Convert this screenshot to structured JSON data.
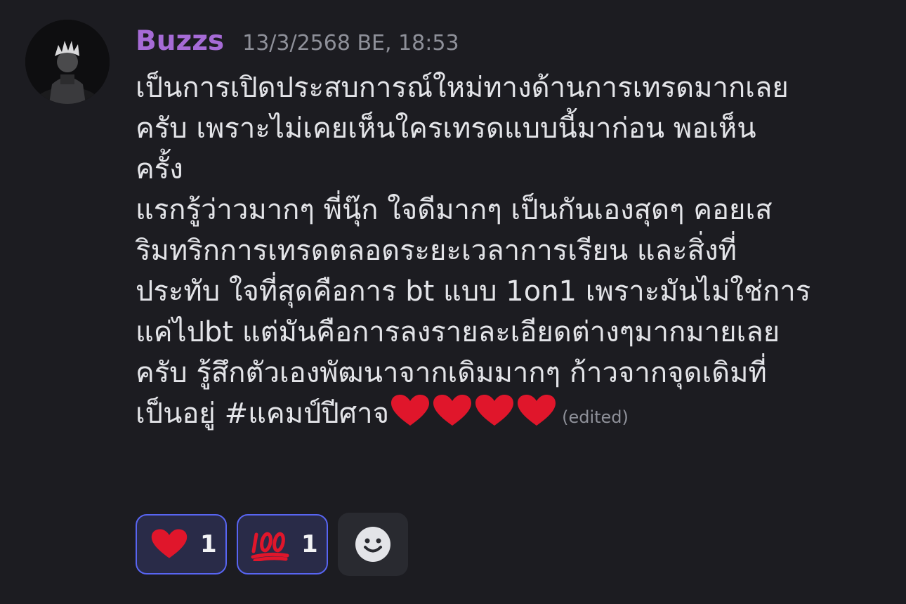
{
  "message": {
    "username": "Buzzs",
    "timestamp": "13/3/2568 BE, 18:53",
    "content": "เป็นการเปิดประสบการณ์ใหม่ทางด้านการเทรดมากเลย\nครับ เพราะไม่เคยเห็นใครเทรดแบบนี้มาก่อน พอเห็น\nครั้ง\nแรกรู้ว่าวมากๆ พี่นุ๊ก ใจดีมากๆ เป็นกันเองสุดๆ คอยเส\nริมทริกการเทรดตลอดระยะเวลาการเรียน และสิ่งที่\nประทับ ใจที่สุดคือการ bt แบบ 1on1 เพราะมันไม่ใช่การ\nแค่ไปbt แต่มันคือการลงรายละเอียดต่างๆมากมายเลย\nครับ รู้สึกตัวเองพัฒนาจากเดิมมากๆ ก้าวจากจุดเดิมที่\nเป็นอยู่ #แคมป์ปีศาจ",
    "trailing_emoji": "heart-emoji x4",
    "edited_label": "(edited)",
    "avatar_icon": "anime-character-avatar"
  },
  "reactions": [
    {
      "icon": "heart-emoji",
      "count": "1",
      "selected": true
    },
    {
      "icon": "hundred-points-emoji",
      "count": "1",
      "selected": true
    }
  ],
  "add_reaction": {
    "icon": "smiley-add-reaction-icon"
  },
  "colors": {
    "background": "#1c1c21",
    "username": "#a66bd6",
    "timestamp": "#8e9099",
    "text": "#e3e4e8",
    "reaction_border": "#5865f2",
    "reaction_bg": "#292b48"
  }
}
